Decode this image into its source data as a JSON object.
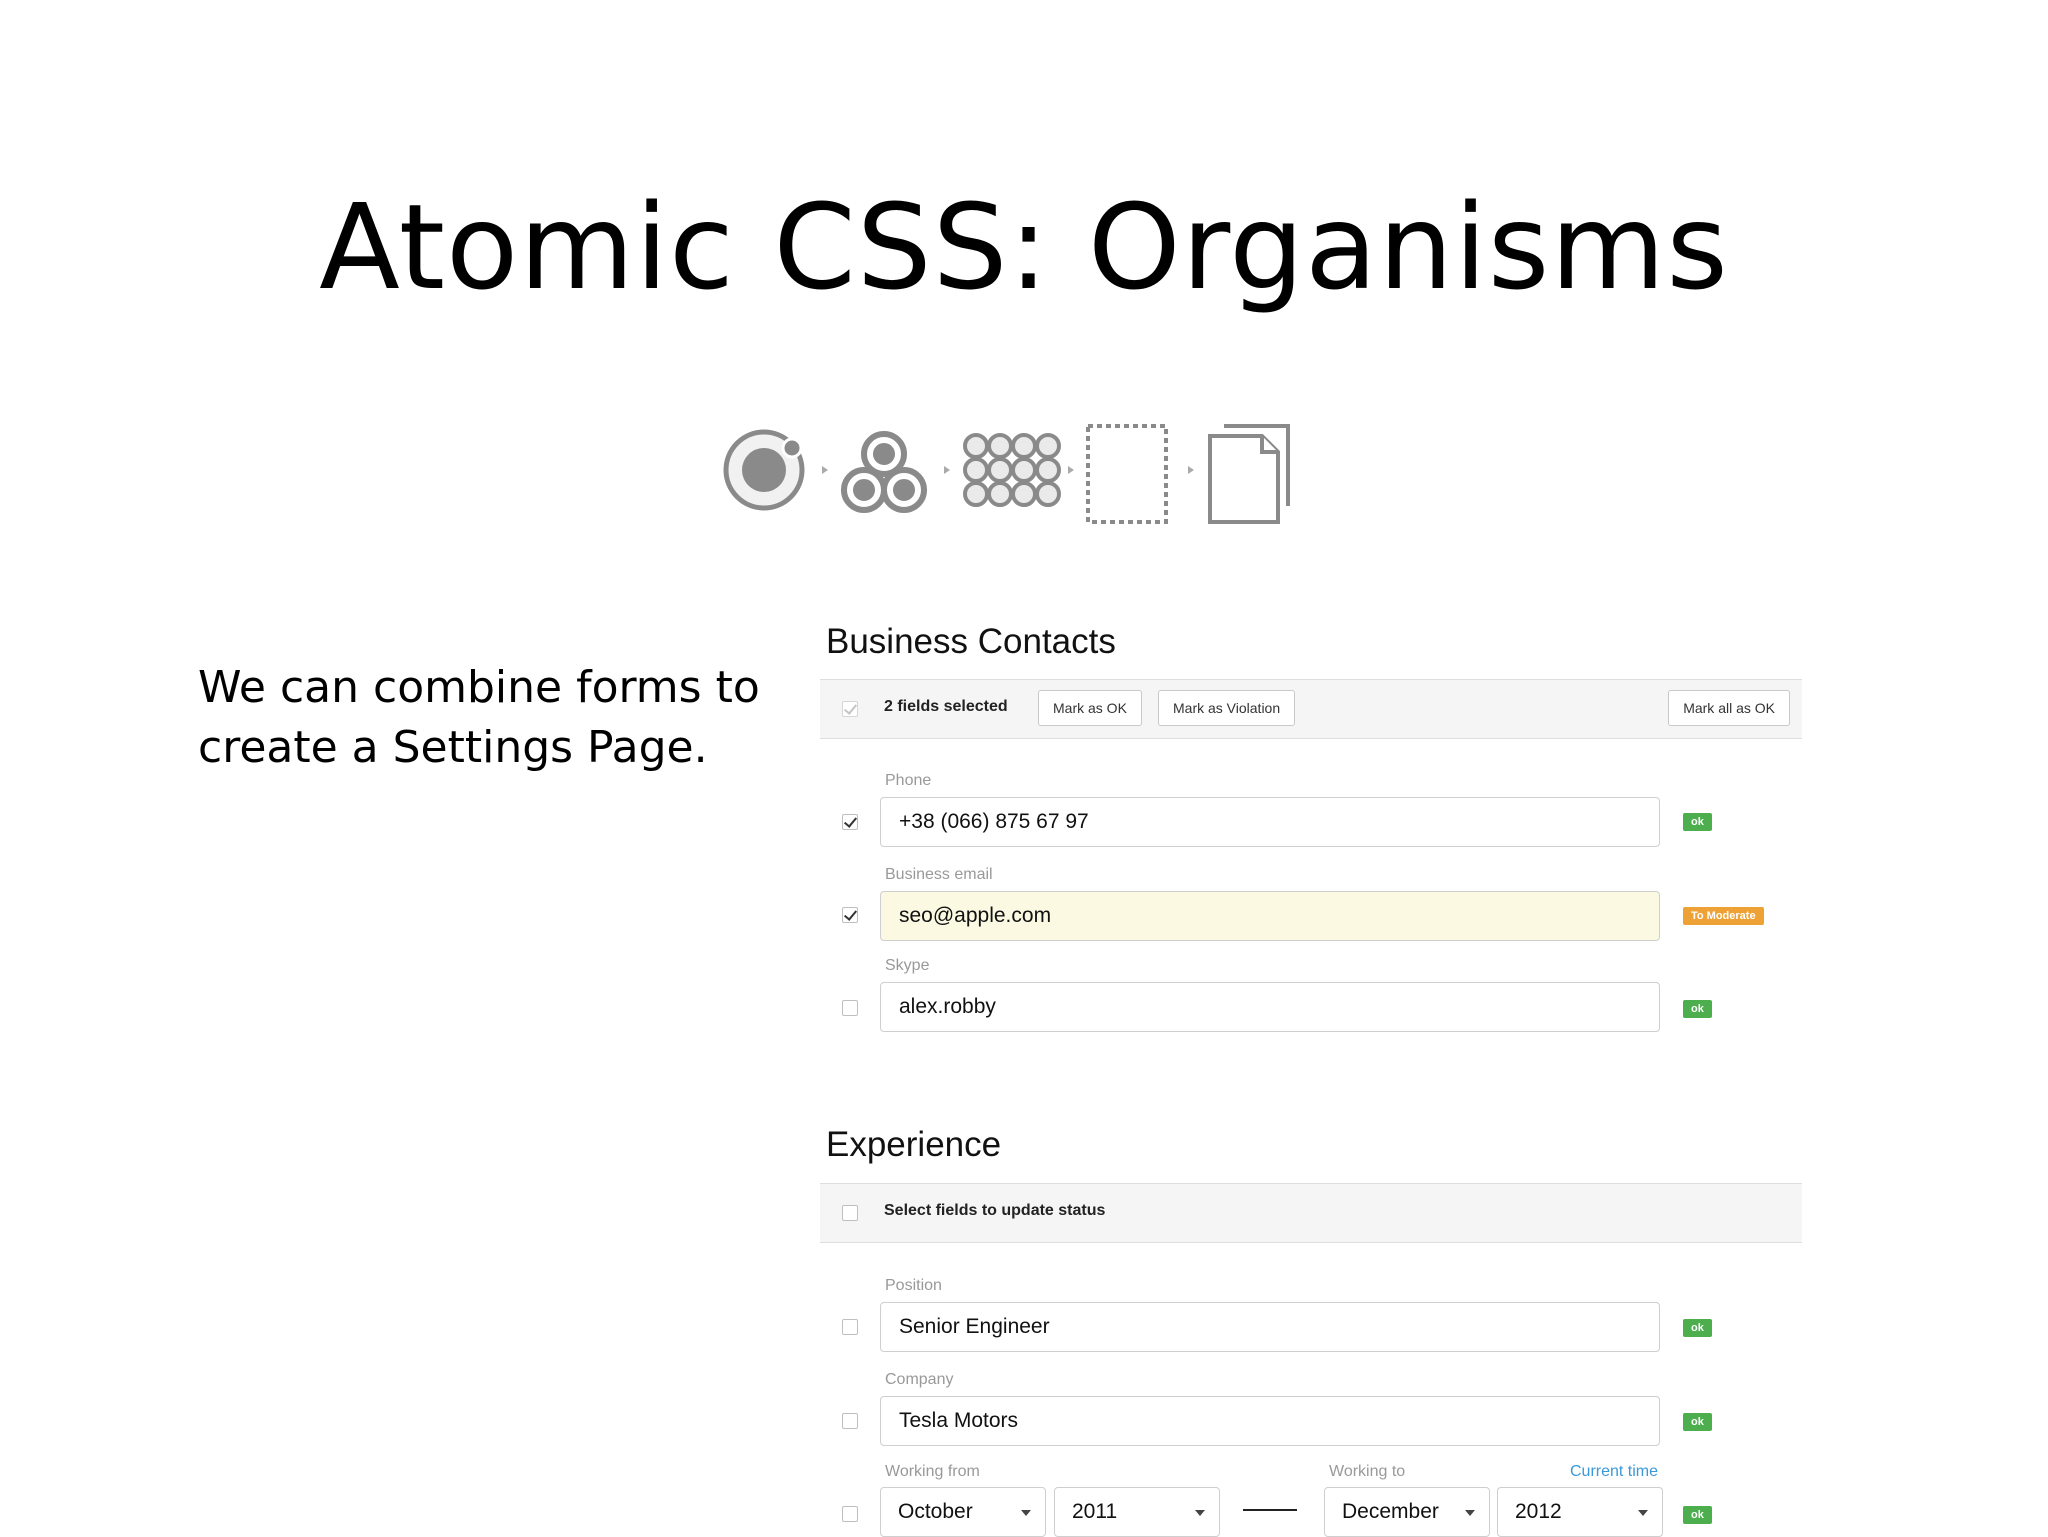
{
  "slide": {
    "title": "Atomic CSS: Organisms",
    "intro": "We can combine forms to create a Settings Page."
  },
  "pipeline": {
    "stages": [
      "atom-icon",
      "molecule-icon",
      "organism-icon",
      "template-icon",
      "page-icon"
    ],
    "color": "#8a8a8a"
  },
  "business": {
    "title": "Business Contacts",
    "bar": {
      "selected_text": "2 fields selected",
      "mark_ok": "Mark as OK",
      "mark_violation": "Mark as Violation",
      "mark_all_ok": "Mark all as OK"
    },
    "fields": [
      {
        "label": "Phone",
        "value": "+38 (066) 875 67 97",
        "checked": true,
        "status": "ok"
      },
      {
        "label": "Business email",
        "value": "seo@apple.com",
        "checked": true,
        "status": "To Moderate"
      },
      {
        "label": "Skype",
        "value": "alex.robby",
        "checked": false,
        "status": "ok"
      }
    ]
  },
  "experience": {
    "title": "Experience",
    "bar": {
      "text": "Select fields to update status"
    },
    "fields": [
      {
        "label": "Position",
        "value": "Senior Engineer",
        "checked": false,
        "status": "ok"
      },
      {
        "label": "Company",
        "value": "Tesla Motors",
        "checked": false,
        "status": "ok"
      }
    ],
    "dates": {
      "from_label": "Working from",
      "to_label": "Working to",
      "current_link": "Current time",
      "from_month": "October",
      "from_year": "2011",
      "to_month": "December",
      "to_year": "2012",
      "status": "ok"
    }
  },
  "colors": {
    "ok": "#4cae4c",
    "moderate": "#eea236",
    "warn_bg": "#fcf9e3",
    "link": "#3a9ad9"
  }
}
